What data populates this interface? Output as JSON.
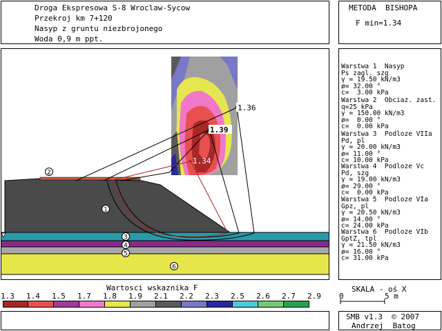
{
  "header": {
    "lines": [
      "Droga Ekspresowa S-8 Wroclaw-Sycow",
      "Przekroj km 7+120",
      "Nasyp z gruntu niezbrojonego",
      "Woda 0,9 m ppt."
    ]
  },
  "method": {
    "title": "METODA  BISHOPA",
    "fmin": "F min=1.34"
  },
  "plot": {
    "safety_labels": [
      "1.36",
      "1.39",
      "1.34"
    ],
    "layer_markers": [
      "2",
      "1",
      "3",
      "4",
      "5",
      "6"
    ]
  },
  "layers": [
    {
      "lines": [
        "Warstwa 1  Nasyp",
        "Ps zagl. szg",
        "γ = 19.50 kN/m3",
        "ø= 32.00 °",
        "c=  3.00 kPa"
      ]
    },
    {
      "lines": [
        "Warstwa 2  Obciaz. zast.",
        "q=25 kPa",
        "γ = 150.00 kN/m3",
        "ø=  0.00 °",
        "c=  0.00 kPa"
      ]
    },
    {
      "lines": [
        "Warstwa 3  Podloze VIIa",
        "Pd, pl",
        "γ = 20.00 kN/m3",
        "ø= 11.00 °",
        "c= 10.00 kPa"
      ]
    },
    {
      "lines": [
        "Warstwa 4  Podloze Vc",
        "Pd, szg",
        "γ = 19.00 kN/m3",
        "ø= 29.00 °",
        "c=  0.00 kPa"
      ]
    },
    {
      "lines": [
        "Warstwa 5  Podloze VIa",
        "Gpz, pl",
        "γ = 20.50 kN/m3",
        "ø= 14.00 °",
        "c= 24.00 kPa"
      ]
    },
    {
      "lines": [
        "Warstwa 6  Podloze VIb",
        "GptZ, tpl",
        "γ = 21.50 kN/m3",
        "ø= 16.00 °",
        "c= 31.00 kPa"
      ]
    }
  ],
  "legend": {
    "title": "Wartosci wskaznika F",
    "values": [
      "1.3",
      "1.4",
      "1.5",
      "1.7",
      "1.8",
      "1.9",
      "2.1",
      "2.2",
      "2.3",
      "2.5",
      "2.6",
      "2.7",
      "2.9"
    ],
    "colors": [
      "#a82828",
      "#e85050",
      "#a03c96",
      "#f078c8",
      "#e6e650",
      "#a0a0a0",
      "#5a5a5a",
      "#7878c8",
      "#2828a0",
      "#50c8dc",
      "#78c878",
      "#28a050"
    ]
  },
  "scale": {
    "title": "SKALA - oś X",
    "zero": "0",
    "five": "5 m"
  },
  "footer": {
    "version": "SMB v1.3  © 2007",
    "author": "Andrzej  Batog"
  },
  "colors": {
    "embankment": "#4a4a4a",
    "layer_teal": "#2a9aa8",
    "layer_purple": "#8a2a8a",
    "layer_gray": "#a8a8a8",
    "layer_yellow": "#e6e64a",
    "load_strip": "#c85a3c"
  }
}
